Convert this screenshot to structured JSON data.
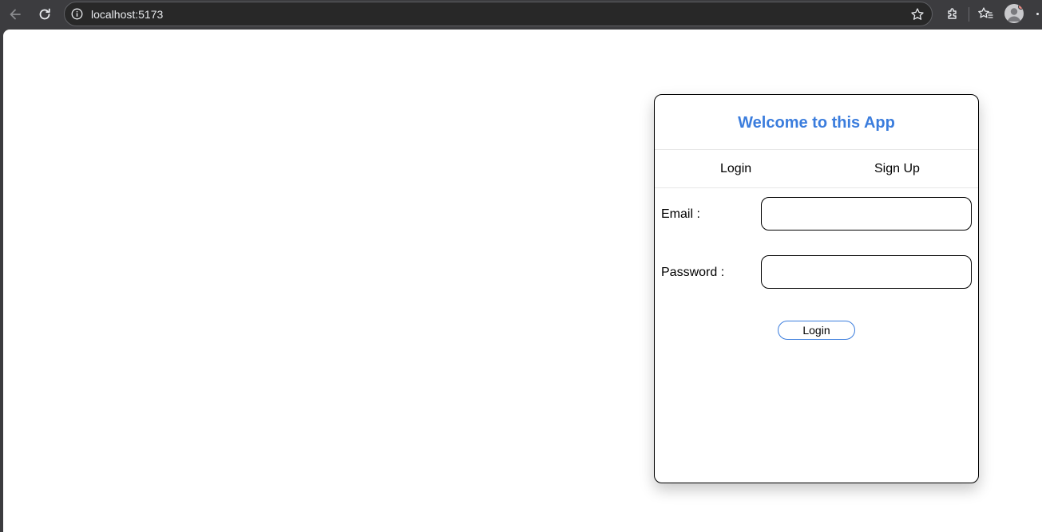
{
  "browser": {
    "url": "localhost:5173",
    "icons": {
      "back": "back-arrow-icon",
      "reload": "reload-icon",
      "info": "site-info-icon",
      "bookmark": "star-icon",
      "extensions": "puzzle-icon",
      "favorites": "favorites-icon",
      "profile": "avatar",
      "menu": "more-icon"
    },
    "colors": {
      "chrome": "#3c3c3f",
      "omnibox": "#282828"
    }
  },
  "app": {
    "title": "Welcome to this App",
    "tabs": [
      {
        "label": "Login"
      },
      {
        "label": "Sign Up"
      }
    ],
    "form": {
      "email_label": "Email :",
      "email_value": "",
      "password_label": "Password :",
      "password_value": "",
      "submit_label": "Login"
    },
    "colors": {
      "accent": "#3b7ddd",
      "border": "#000000"
    }
  }
}
